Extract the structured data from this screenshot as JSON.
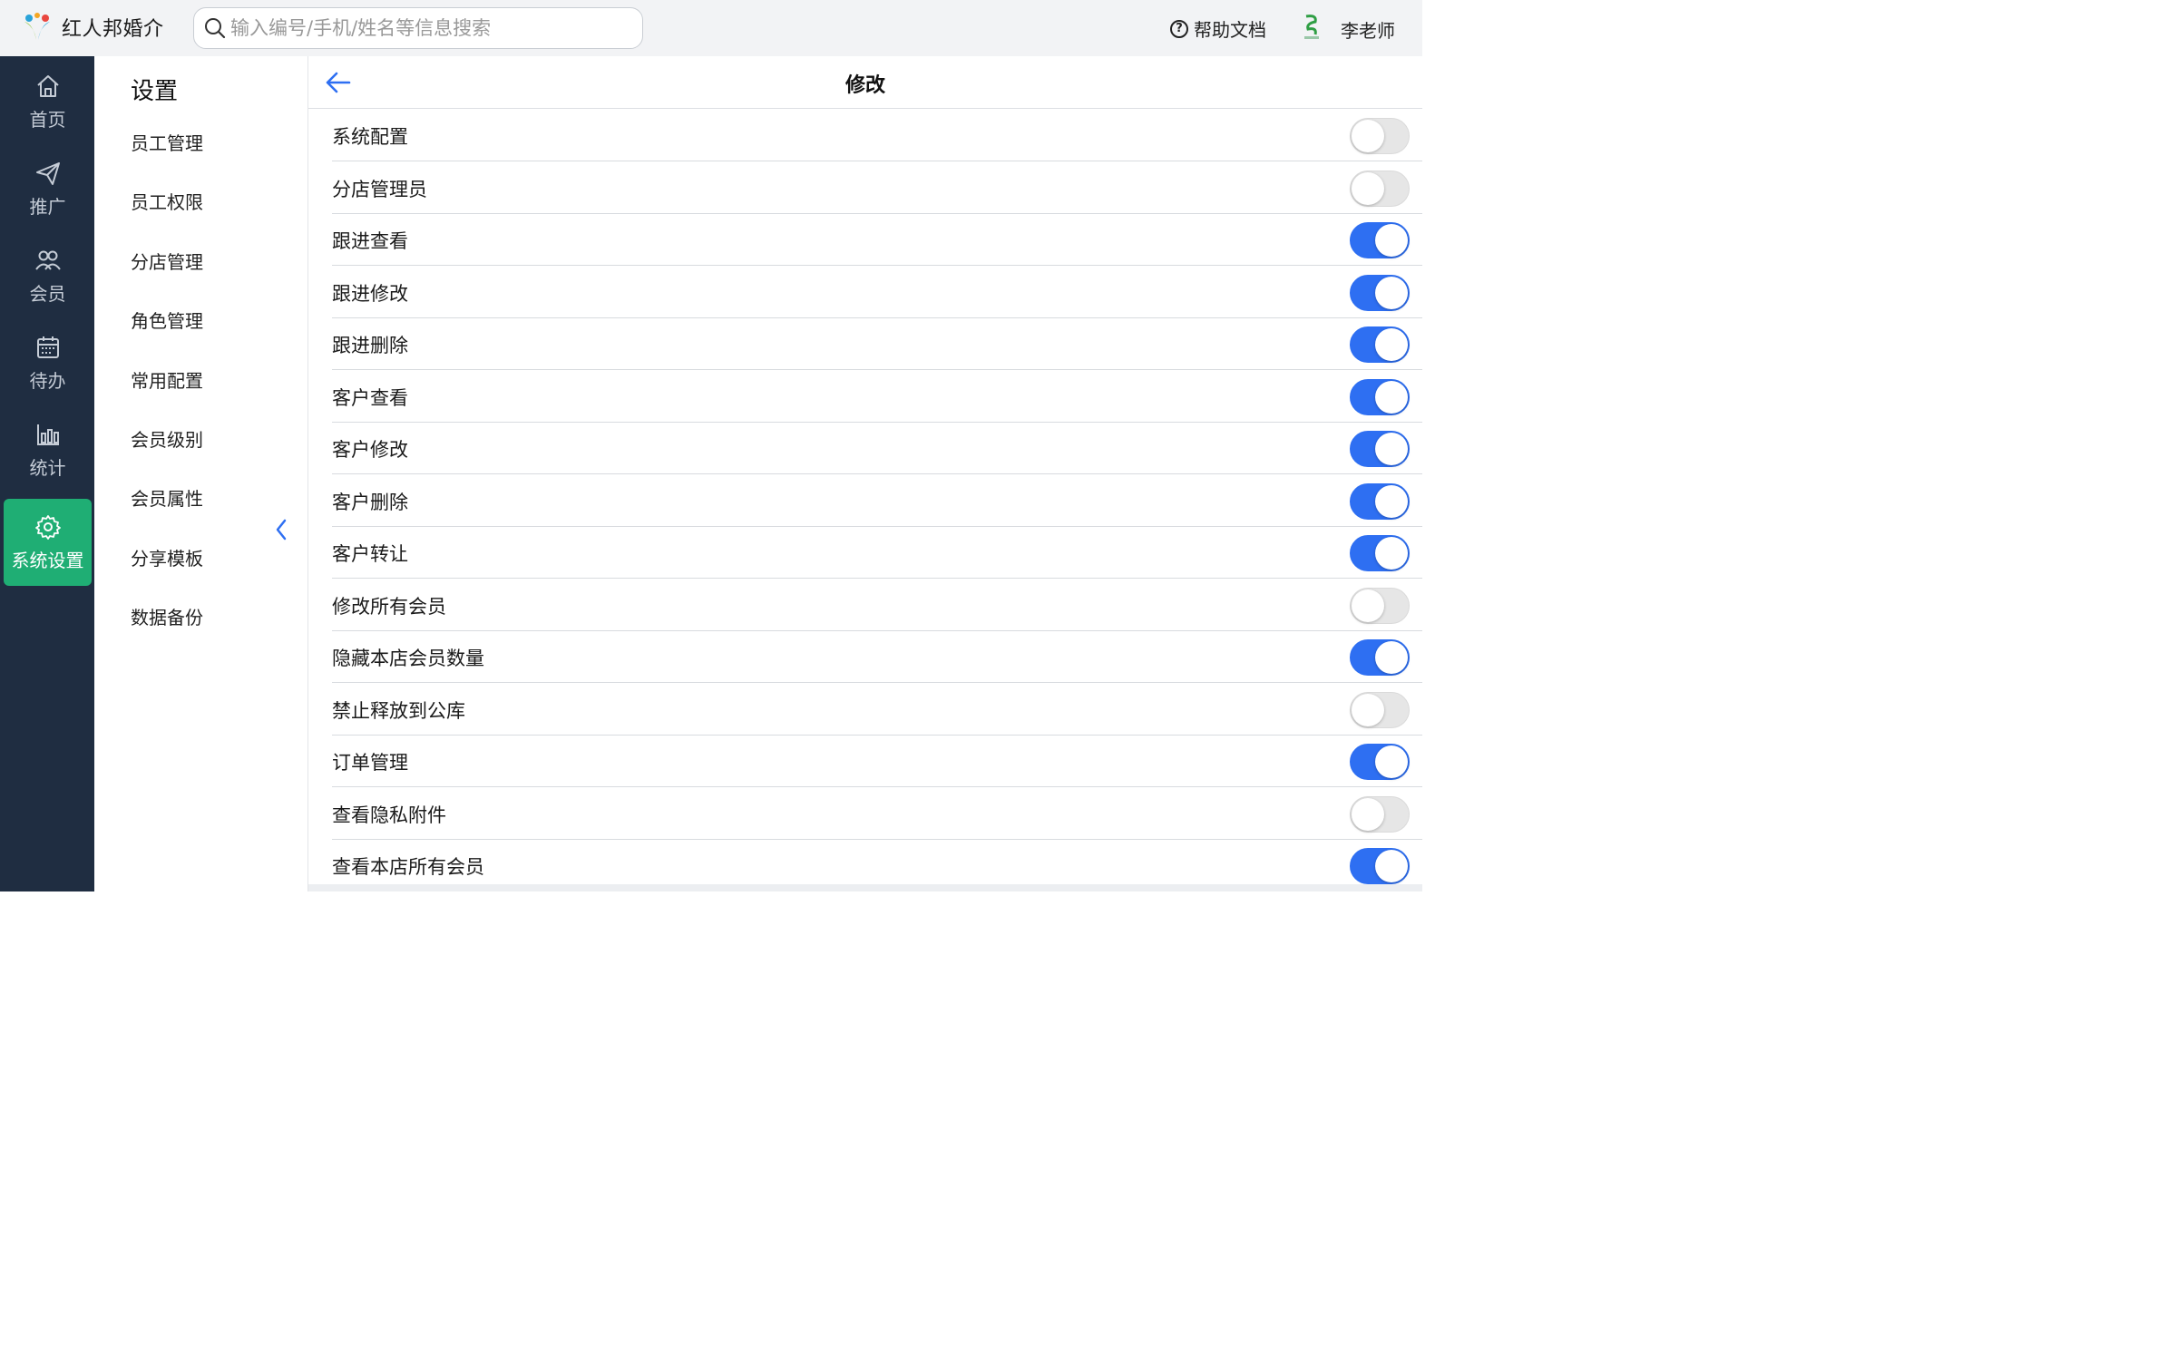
{
  "header": {
    "brand_name": "红人邦婚介",
    "search_placeholder": "输入编号/手机/姓名等信息搜索",
    "help_label": "帮助文档",
    "user_name": "李老师"
  },
  "leftnav": {
    "items": [
      {
        "label": "首页",
        "icon": "home-icon"
      },
      {
        "label": "推广",
        "icon": "send-icon"
      },
      {
        "label": "会员",
        "icon": "users-icon"
      },
      {
        "label": "待办",
        "icon": "calendar-icon"
      },
      {
        "label": "统计",
        "icon": "bar-chart-icon"
      },
      {
        "label": "系统设置",
        "icon": "gear-icon",
        "active": true
      }
    ],
    "active_color": "#1fae74",
    "bg_color": "#1f2d41"
  },
  "submenu": {
    "title": "设置",
    "items": [
      "员工管理",
      "员工权限",
      "分店管理",
      "角色管理",
      "常用配置",
      "会员级别",
      "会员属性",
      "分享模板",
      "数据备份"
    ]
  },
  "main": {
    "title": "修改",
    "toggle_on_color": "#2e6ff2",
    "permissions": [
      {
        "label": "系统配置",
        "enabled": false
      },
      {
        "label": "分店管理员",
        "enabled": false
      },
      {
        "label": "跟进查看",
        "enabled": true
      },
      {
        "label": "跟进修改",
        "enabled": true
      },
      {
        "label": "跟进删除",
        "enabled": true
      },
      {
        "label": "客户查看",
        "enabled": true
      },
      {
        "label": "客户修改",
        "enabled": true
      },
      {
        "label": "客户删除",
        "enabled": true
      },
      {
        "label": "客户转让",
        "enabled": true
      },
      {
        "label": "修改所有会员",
        "enabled": false
      },
      {
        "label": "隐藏本店会员数量",
        "enabled": true
      },
      {
        "label": "禁止释放到公库",
        "enabled": false
      },
      {
        "label": "订单管理",
        "enabled": true
      },
      {
        "label": "查看隐私附件",
        "enabled": false
      },
      {
        "label": "查看本店所有会员",
        "enabled": true
      }
    ]
  }
}
